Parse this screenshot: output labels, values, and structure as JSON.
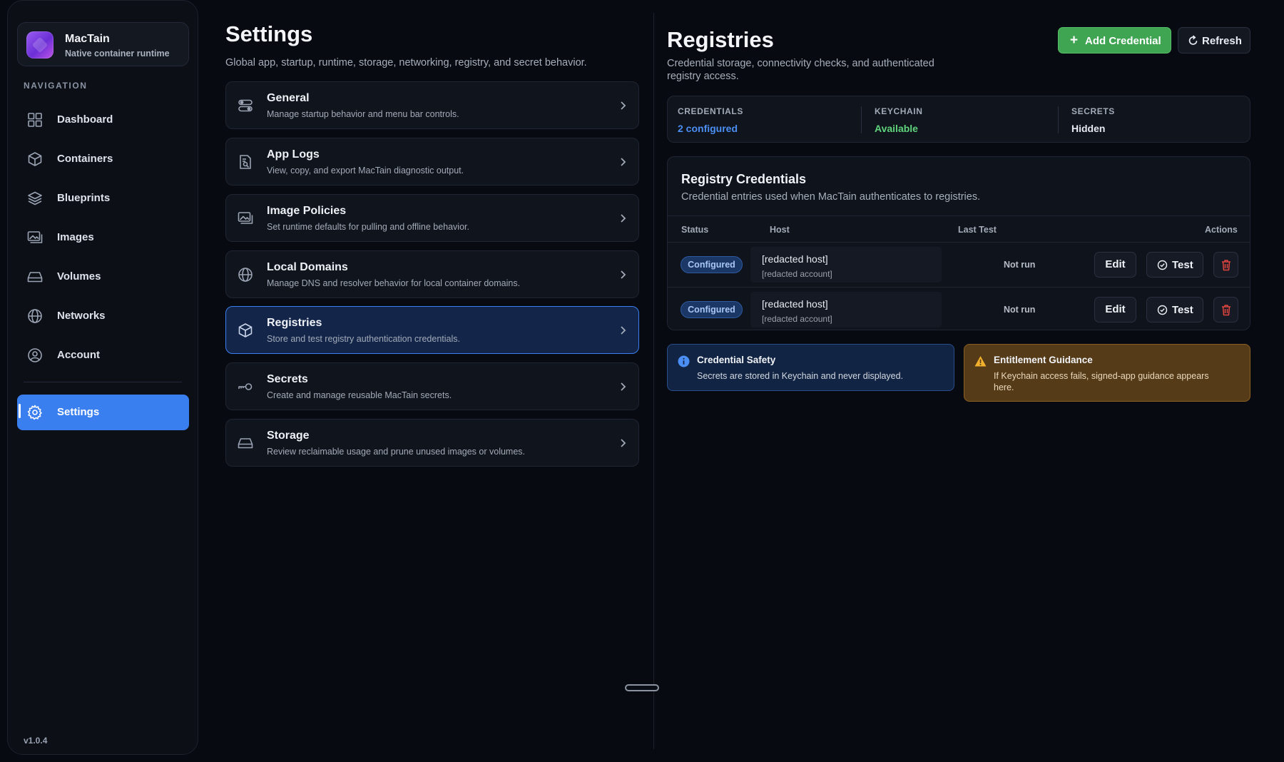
{
  "app": {
    "name": "MacTain",
    "subtitle": "Native container runtime",
    "version": "v1.0.4"
  },
  "sidebar": {
    "heading": "NAVIGATION",
    "items": [
      {
        "label": "Dashboard",
        "icon": "dashboard-grid-icon"
      },
      {
        "label": "Containers",
        "icon": "box-icon"
      },
      {
        "label": "Blueprints",
        "icon": "layers-icon"
      },
      {
        "label": "Images",
        "icon": "images-icon"
      },
      {
        "label": "Volumes",
        "icon": "drive-icon"
      },
      {
        "label": "Networks",
        "icon": "globe-icon"
      },
      {
        "label": "Account",
        "icon": "user-circle-icon"
      }
    ],
    "settings_label": "Settings",
    "active": "Settings"
  },
  "settings": {
    "title": "Settings",
    "subtitle": "Global app, startup, runtime, storage, networking, registry, and secret behavior.",
    "cards": [
      {
        "title": "General",
        "desc": "Manage startup behavior and menu bar controls.",
        "icon": "toggles-icon"
      },
      {
        "title": "App Logs",
        "desc": "View, copy, and export MacTain diagnostic output.",
        "icon": "document-search-icon"
      },
      {
        "title": "Image Policies",
        "desc": "Set runtime defaults for pulling and offline behavior.",
        "icon": "images-icon"
      },
      {
        "title": "Local Domains",
        "desc": "Manage DNS and resolver behavior for local container domains.",
        "icon": "globe-icon"
      },
      {
        "title": "Registries",
        "desc": "Store and test registry authentication credentials.",
        "icon": "box-icon"
      },
      {
        "title": "Secrets",
        "desc": "Create and manage reusable MacTain secrets.",
        "icon": "key-icon"
      },
      {
        "title": "Storage",
        "desc": "Review reclaimable usage and prune unused images or volumes.",
        "icon": "drive-icon"
      }
    ],
    "active": "Registries"
  },
  "registries": {
    "title": "Registries",
    "subtitle": "Credential storage, connectivity checks, and authenticated registry access.",
    "add_label": "Add Credential",
    "refresh_label": "Refresh",
    "stats": [
      {
        "label": "CREDENTIALS",
        "value": "2 configured",
        "color": "#4b8ff5"
      },
      {
        "label": "KEYCHAIN",
        "value": "Available",
        "color": "#5fd37b"
      },
      {
        "label": "SECRETS",
        "value": "Hidden",
        "color": "#e6e9ef"
      }
    ],
    "panel": {
      "title": "Registry Credentials",
      "subtitle": "Credential entries used when MacTain authenticates to registries.",
      "columns": {
        "status": "Status",
        "host": "Host",
        "last_test": "Last Test",
        "actions": "Actions"
      },
      "rows": [
        {
          "status": "Configured",
          "host": "[redacted host]",
          "account": "[redacted account]",
          "last_test": "Not run",
          "edit": "Edit",
          "test": "Test"
        },
        {
          "status": "Configured",
          "host": "[redacted host]",
          "account": "[redacted account]",
          "last_test": "Not run",
          "edit": "Edit",
          "test": "Test"
        }
      ]
    },
    "callouts": {
      "safety": {
        "title": "Credential Safety",
        "body": "Secrets are stored in Keychain and never displayed."
      },
      "entitlement": {
        "title": "Entitlement Guidance",
        "body": "If Keychain access fails, signed-app guidance appears here."
      }
    }
  },
  "colors": {
    "accent": "#3a7ff0",
    "success": "#3fa552",
    "danger": "#e0453f",
    "warning": "#f2b02e"
  }
}
